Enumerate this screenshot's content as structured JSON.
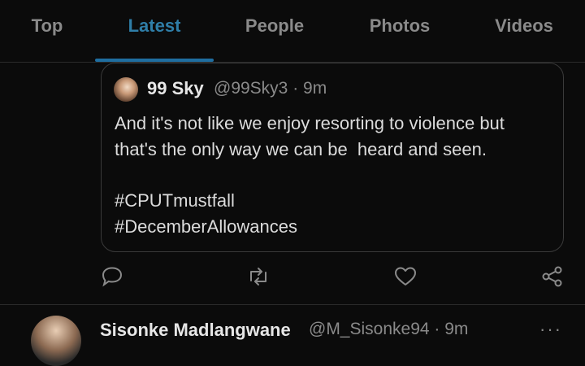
{
  "tabs": [
    {
      "label": "Top"
    },
    {
      "label": "Latest"
    },
    {
      "label": "People"
    },
    {
      "label": "Photos"
    },
    {
      "label": "Videos"
    }
  ],
  "active_tab": "Latest",
  "quoted_tweet": {
    "author_name": "99 Sky",
    "handle_time": "@99Sky3 · 9m",
    "lines": [
      "And it's not like we enjoy resorting to violence but",
      "that's the only way we can be  heard and seen.",
      "#CPUTmustfall",
      "#DecemberAllowances"
    ]
  },
  "actions": [
    {
      "icon": "reply-icon"
    },
    {
      "icon": "retweet-icon"
    },
    {
      "icon": "like-icon"
    },
    {
      "icon": "share-icon"
    }
  ],
  "next_tweet": {
    "author_name": "Sisonke Madlangwane",
    "handle_time": "@M_Sisonke94 · 9m",
    "more": "···"
  },
  "colors": {
    "background": "#0b0b0b",
    "accent": "#2f7ea8",
    "muted_text": "#8a8a8a",
    "border": "#3a3a3a"
  }
}
